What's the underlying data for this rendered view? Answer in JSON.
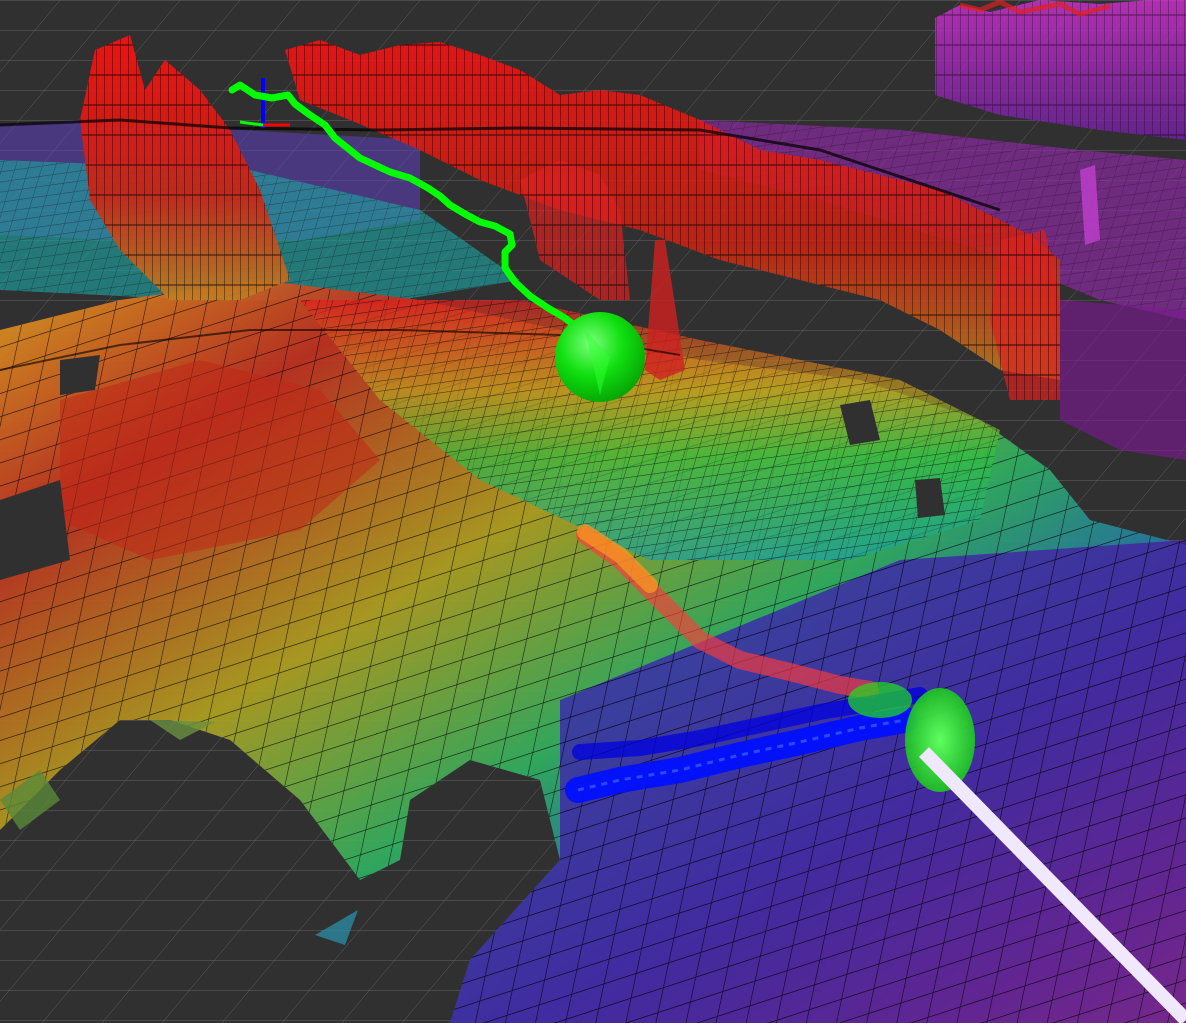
{
  "scene": {
    "background_color": "#303030",
    "grid_color": "#a0a0a0",
    "mesh_edge_color": "#000000",
    "elevation_colormap": [
      "#ff0000",
      "#e07a10",
      "#c0b020",
      "#40c030",
      "#20a0a0",
      "#3040d0",
      "#6a20b0",
      "#d020d0"
    ],
    "trajectory_color": "#00ff00",
    "goal_marker_color": "#00ff00",
    "footstep_plan_color": "#0000ff",
    "planned_path_color": "#ff3a3a",
    "ray_color": "#f0e8ff",
    "axis_colors": {
      "x": "#ff0000",
      "y": "#00ff00",
      "z": "#0000ff"
    }
  }
}
